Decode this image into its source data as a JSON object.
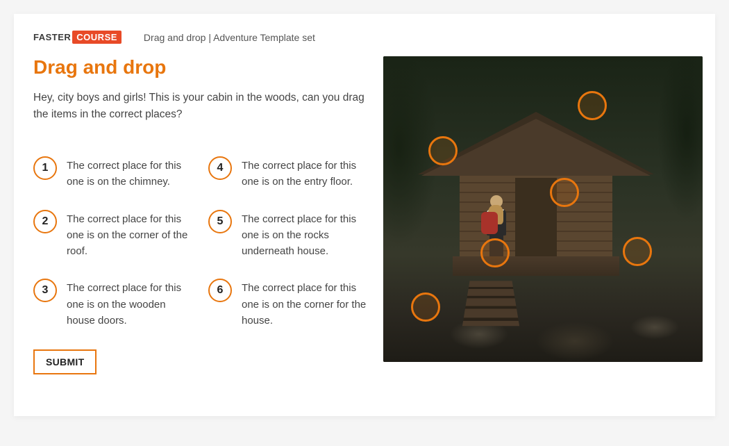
{
  "logo": {
    "part1": "FASTER",
    "part2": "COURSE"
  },
  "breadcrumb": "Drag and drop | Adventure Template set",
  "title": "Drag and drop",
  "intro": "Hey, city boys and girls! This is your cabin in the woods, can you drag the items in the correct places?",
  "items": [
    {
      "number": "1",
      "text": "The correct place for this one is on the chimney."
    },
    {
      "number": "2",
      "text": "The correct place for this one is on the corner of the roof."
    },
    {
      "number": "3",
      "text": "The correct place for this one is on the wooden house doors."
    },
    {
      "number": "4",
      "text": "The correct place for this one is on the entry floor."
    },
    {
      "number": "5",
      "text": "The correct place for this one is on the rocks underneath house."
    },
    {
      "number": "6",
      "text": "The correct place for this one is on the corner for the house."
    }
  ],
  "submit_label": "SUBMIT",
  "accent_color": "#e8760e"
}
